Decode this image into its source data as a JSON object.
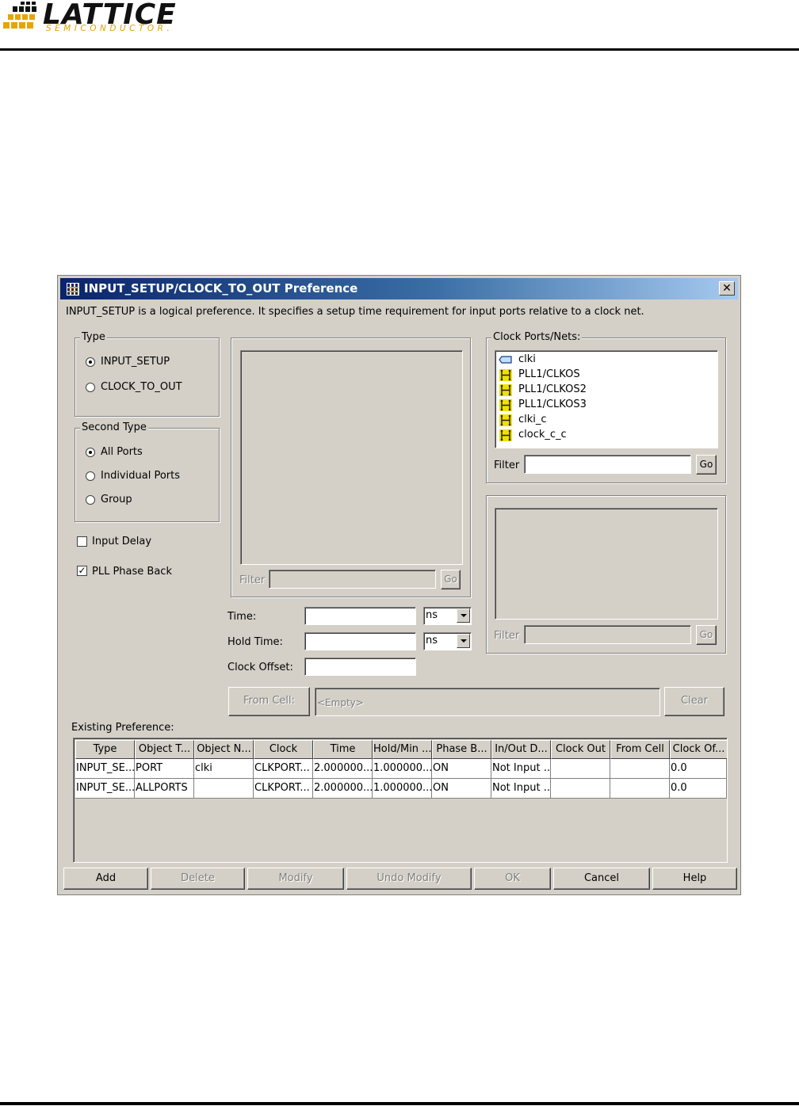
{
  "header": {
    "logo_text": "LATTICE",
    "logo_subtitle": "SEMICONDUCTOR."
  },
  "dialog": {
    "title": "INPUT_SETUP/CLOCK_TO_OUT Preference",
    "close_label": "✕",
    "description": "INPUT_SETUP is a logical preference. It specifies a setup time requirement for input ports relative to a clock net.",
    "type_group": {
      "legend": "Type",
      "options": [
        "INPUT_SETUP",
        "CLOCK_TO_OUT"
      ],
      "selected": "INPUT_SETUP"
    },
    "second_type_group": {
      "legend": "Second Type",
      "options": [
        "All Ports",
        "Individual Ports",
        "Group"
      ],
      "selected": "All Ports"
    },
    "input_delay": {
      "label": "Input Delay",
      "checked": false
    },
    "pll_phase_back": {
      "label": "PLL Phase Back",
      "checked": true
    },
    "center_list": {
      "filter_label": "Filter",
      "filter_value": "",
      "go_label": "Go"
    },
    "clock_ports": {
      "legend": "Clock Ports/Nets:",
      "items": [
        {
          "label": "clki",
          "icon": "port-icon"
        },
        {
          "label": "PLL1/CLKOS",
          "icon": "net-icon"
        },
        {
          "label": "PLL1/CLKOS2",
          "icon": "net-icon"
        },
        {
          "label": "PLL1/CLKOS3",
          "icon": "net-icon"
        },
        {
          "label": "clki_c",
          "icon": "net-icon"
        },
        {
          "label": "clock_c_c",
          "icon": "net-icon"
        }
      ],
      "filter_label": "Filter",
      "filter_value": "",
      "go_label": "Go"
    },
    "right_lower_list": {
      "filter_label": "Filter",
      "filter_value": "",
      "go_label": "Go"
    },
    "time": {
      "label": "Time:",
      "value": "",
      "unit": "ns"
    },
    "hold_time": {
      "label": "Hold Time:",
      "value": "",
      "unit": "ns"
    },
    "clock_offset": {
      "label": "Clock Offset:",
      "value": ""
    },
    "from_cell": {
      "button": "From Cell:",
      "placeholder": "<Empty>",
      "clear": "Clear"
    },
    "existing": {
      "label": "Existing Preference:",
      "columns": [
        "Type",
        "Object T...",
        "Object N...",
        "Clock",
        "Time",
        "Hold/Min ...",
        "Phase B...",
        "In/Out D...",
        "Clock Out",
        "From Cell",
        "Clock Of..."
      ],
      "rows": [
        [
          "INPUT_SE...",
          "PORT",
          "clki",
          "CLKPORT...",
          "2.000000...",
          "1.000000...",
          "ON",
          "Not Input ...",
          "",
          "",
          "0.0"
        ],
        [
          "INPUT_SE...",
          "ALLPORTS",
          "",
          "CLKPORT...",
          "2.000000...",
          "1.000000...",
          "ON",
          "Not Input ...",
          "",
          "",
          "0.0"
        ]
      ]
    },
    "buttons": {
      "add": "Add",
      "delete": "Delete",
      "modify": "Modify",
      "undo_modify": "Undo Modify",
      "ok": "OK",
      "cancel": "Cancel",
      "help": "Help"
    },
    "colors": {
      "titlebar": "#0a246a",
      "face": "#d4d0c8",
      "net_icon": "#f0e000"
    }
  }
}
